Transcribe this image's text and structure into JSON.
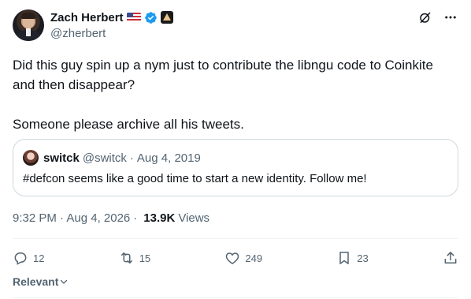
{
  "author": {
    "display_name": "Zach Herbert",
    "handle": "@zherbert",
    "badges": [
      "us-flag",
      "verified-check",
      "affiliate-badge"
    ],
    "verified_color": "#1d9bf0"
  },
  "top_actions": {
    "grok_icon": "grok-icon",
    "more_icon": "more-icon"
  },
  "tweet": {
    "line1": "Did this guy spin up a nym just to contribute the libngu code to Coinkite",
    "line2": "and then disappear?",
    "line3": "Someone please archive all his tweets."
  },
  "quote": {
    "name": "switck",
    "handle": "@switck",
    "dot": "·",
    "date": "Aug 4, 2019",
    "text": "#defcon seems like a good time to start a new identity. Follow me!"
  },
  "meta": {
    "time": "9:32 PM · Aug 4, 2026",
    "sep": "·",
    "views_count": "13.9K",
    "views_label": "Views"
  },
  "actions": {
    "replies": "12",
    "reposts": "15",
    "likes": "249",
    "bookmarks": "23"
  },
  "sort": {
    "label": "Relevant"
  },
  "colors": {
    "text": "#0f1419",
    "secondary": "#536471",
    "border": "#cfd9de",
    "accent": "#1d9bf0"
  }
}
